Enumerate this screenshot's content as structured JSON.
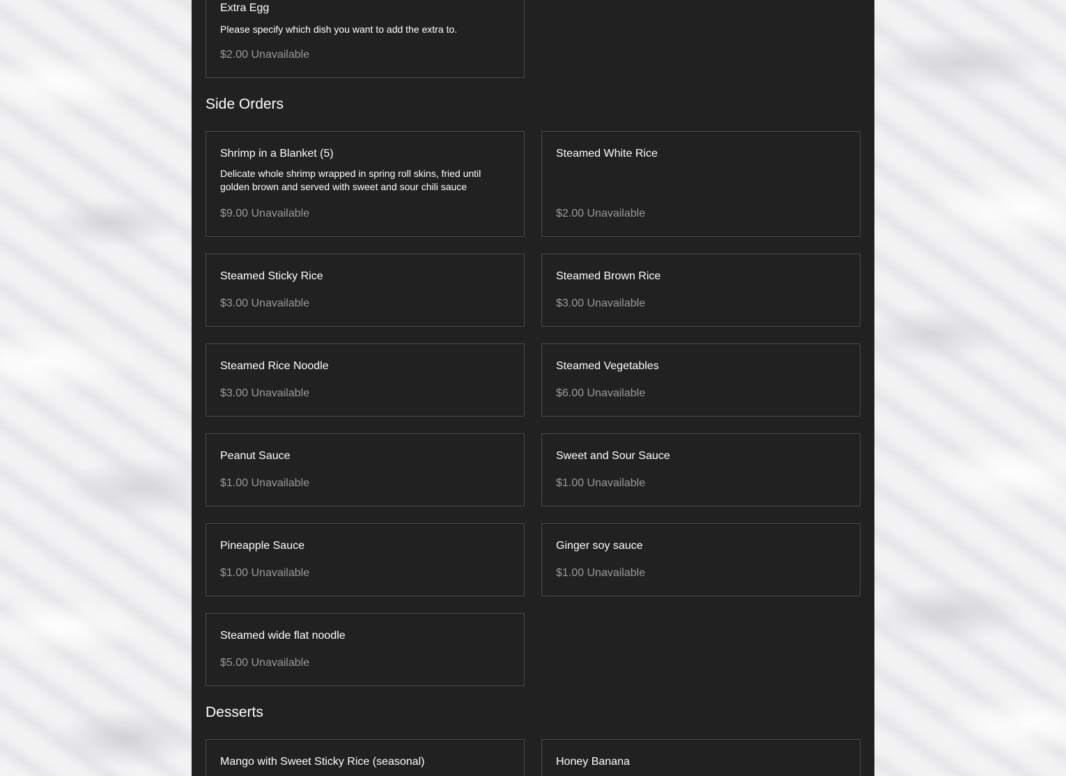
{
  "colors": {
    "panel_background": "#212121",
    "card_border": "#4a4a4a",
    "text_primary": "#ffffff",
    "text_muted": "#9a9a9a",
    "page_background": "#ececee"
  },
  "top_item": {
    "name": "Extra Egg",
    "description": "Please specify which dish you want to add the extra to.",
    "price_status": "$2.00 Unavailable"
  },
  "side_orders": {
    "heading": "Side Orders",
    "items": [
      {
        "name": "Shrimp in a Blanket (5)",
        "description": "Delicate whole shrimp wrapped in spring roll skins, fried until golden brown and served with sweet and sour chili sauce",
        "price_status": "$9.00 Unavailable"
      },
      {
        "name": "Steamed White Rice",
        "price_status": "$2.00 Unavailable"
      },
      {
        "name": "Steamed Sticky Rice",
        "price_status": "$3.00 Unavailable"
      },
      {
        "name": "Steamed Brown Rice",
        "price_status": "$3.00 Unavailable"
      },
      {
        "name": "Steamed Rice Noodle",
        "price_status": "$3.00 Unavailable"
      },
      {
        "name": "Steamed Vegetables",
        "price_status": "$6.00 Unavailable"
      },
      {
        "name": "Peanut Sauce",
        "price_status": "$1.00 Unavailable"
      },
      {
        "name": "Sweet and Sour Sauce",
        "price_status": "$1.00 Unavailable"
      },
      {
        "name": "Pineapple Sauce",
        "price_status": "$1.00 Unavailable"
      },
      {
        "name": "Ginger soy sauce",
        "price_status": "$1.00 Unavailable"
      },
      {
        "name": "Steamed wide flat noodle",
        "price_status": "$5.00 Unavailable"
      }
    ]
  },
  "desserts": {
    "heading": "Desserts",
    "items": [
      {
        "name": "Mango with Sweet Sticky Rice (seasonal)"
      },
      {
        "name": "Honey Banana"
      }
    ]
  }
}
